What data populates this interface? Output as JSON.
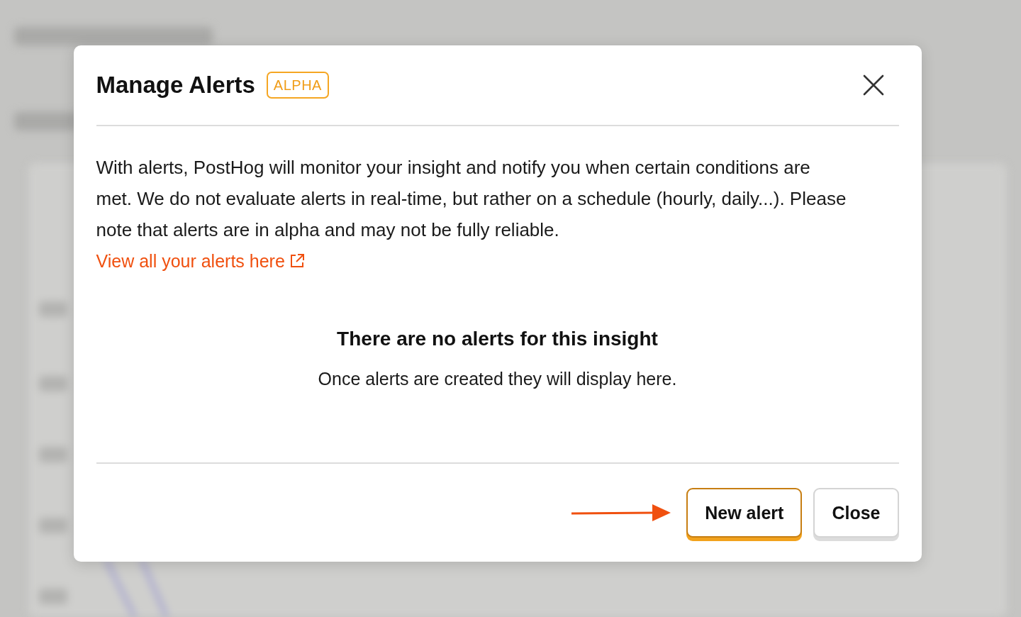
{
  "dialog": {
    "title": "Manage Alerts",
    "badge": "ALPHA",
    "description": "With alerts, PostHog will monitor your insight and notify you when certain conditions are met. We do not evaluate alerts in real-time, but rather on a schedule (hourly, daily...). Please note that alerts are in alpha and may not be fully reliable.",
    "link": "View all your alerts here",
    "empty_state": {
      "title": "There are no alerts for this insight",
      "message": "Once alerts are created they will display here."
    },
    "buttons": [
      {
        "label": "New alert",
        "kind": "primary"
      },
      {
        "label": "Close",
        "kind": "secondary"
      }
    ]
  }
}
